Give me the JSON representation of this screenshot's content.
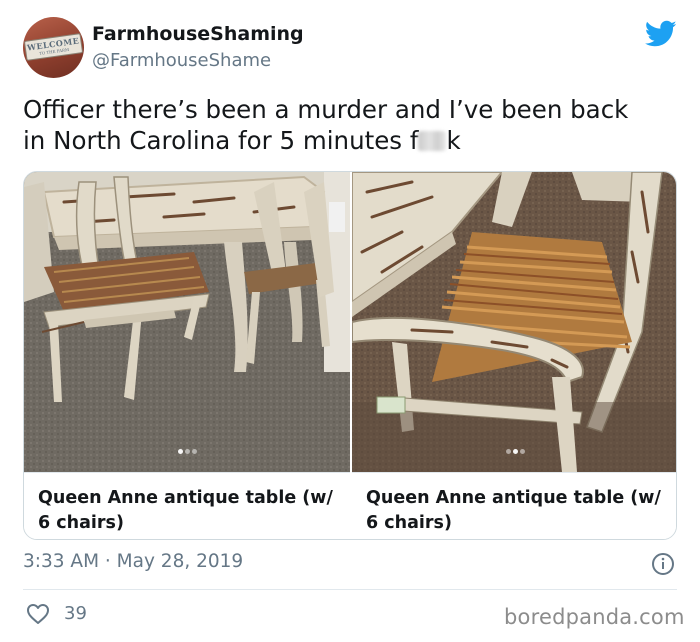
{
  "user": {
    "display_name": "FarmhouseShaming",
    "handle": "@FarmhouseShame",
    "avatar_sign_main": "WELCOME",
    "avatar_sign_sub": "TO THE FARM"
  },
  "tweet": {
    "text_line1": "Officer there’s been a murder and I’ve been back",
    "text_line2_prefix": "in North Carolina for 5 minutes f",
    "text_line2_suffix": "k"
  },
  "cards": [
    {
      "caption": "Queen Anne antique table (w/ 6 chairs)"
    },
    {
      "caption": "Queen Anne antique table (w/ 6 chairs)"
    }
  ],
  "meta": {
    "timestamp": "3:33 AM · May 28, 2019",
    "likes": "39"
  },
  "watermark": "boredpanda.com",
  "colors": {
    "twitter_blue": "#1da1f2",
    "secondary_text": "#657786",
    "primary_text": "#14171a"
  },
  "icons": {
    "brand": "twitter-bird-icon",
    "info": "info-icon",
    "like": "heart-icon"
  }
}
